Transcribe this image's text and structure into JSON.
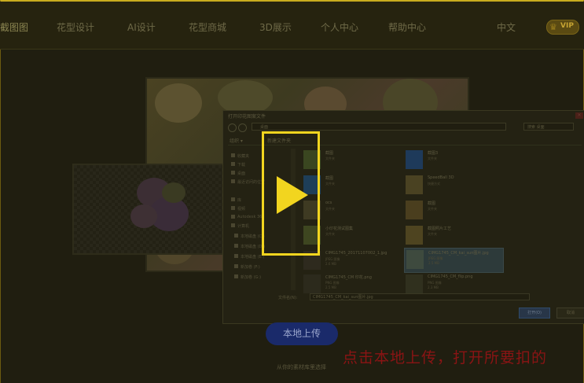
{
  "nav": {
    "items": [
      {
        "label": "截图图",
        "active": true
      },
      {
        "label": "花型设计"
      },
      {
        "label": "AI设计"
      },
      {
        "label": "花型商城"
      },
      {
        "label": "3D展示"
      },
      {
        "label": "个人中心"
      },
      {
        "label": "帮助中心"
      }
    ],
    "language": "中文",
    "vip_badge": "VIP"
  },
  "file_dialog": {
    "title": "打开印花图案文件",
    "address": "桌面",
    "search_placeholder": "搜索 桌面",
    "toolbar": {
      "organize": "组织 ▾",
      "new_folder": "新建文件夹"
    },
    "sidebar": [
      {
        "label": "收藏夹"
      },
      {
        "label": "下载"
      },
      {
        "label": "桌面"
      },
      {
        "label": "最近访问的位置"
      },
      {
        "label": "库"
      },
      {
        "label": "视频"
      },
      {
        "label": "Autodesk 360"
      },
      {
        "label": "计算机"
      },
      {
        "label": "本地磁盘 (C:)"
      },
      {
        "label": "本地磁盘 (D:)"
      },
      {
        "label": "本地磁盘 (E:)"
      },
      {
        "label": "新加卷 (F:)"
      },
      {
        "label": "新加卷 (G:)"
      }
    ],
    "files": [
      {
        "name": "截图",
        "meta1": "文件夹",
        "meta2": ""
      },
      {
        "name": "截图3",
        "meta1": "文件夹",
        "meta2": ""
      },
      {
        "name": "截图",
        "meta1": "文件夹",
        "meta2": ""
      },
      {
        "name": "SpeedBall 3D",
        "meta1": "快捷方式",
        "meta2": ""
      },
      {
        "name": "ocs",
        "meta1": "文件夹",
        "meta2": ""
      },
      {
        "name": "截图",
        "meta1": "文件夹",
        "meta2": ""
      },
      {
        "name": "小印花测试图集",
        "meta1": "文件夹",
        "meta2": ""
      },
      {
        "name": "截图照片工艺",
        "meta1": "文件夹",
        "meta2": ""
      },
      {
        "name": "CIMG1745_20171107002_1.jpg",
        "meta1": "JPEG 图像",
        "meta2": "2.6 MB"
      },
      {
        "name": "CIMG1745_CM_kai_sun图片.jpg",
        "meta1": "JPEG 图像",
        "meta2": "2.5 MB"
      },
      {
        "name": "CIMG1745_CM 印花.png",
        "meta1": "PNG 图像",
        "meta2": "2.5 MB"
      },
      {
        "name": "CIMG1745_CM_flip.png",
        "meta1": "PNG 图像",
        "meta2": "2.3 MB"
      }
    ],
    "filename_label": "文件名(N):",
    "filename_value": "CIMG1745_CM_kai_sun图片.jpg",
    "open_button": "打开(O)",
    "cancel_button": "取消"
  },
  "upload_button": "本地上传",
  "caption": "点击本地上传，打开所要扣的",
  "hint_text": "从你的素材库里选择",
  "colors": {
    "accent": "#f2d51f",
    "caption": "#8a1414",
    "upload_button": "#1a2a6a"
  }
}
